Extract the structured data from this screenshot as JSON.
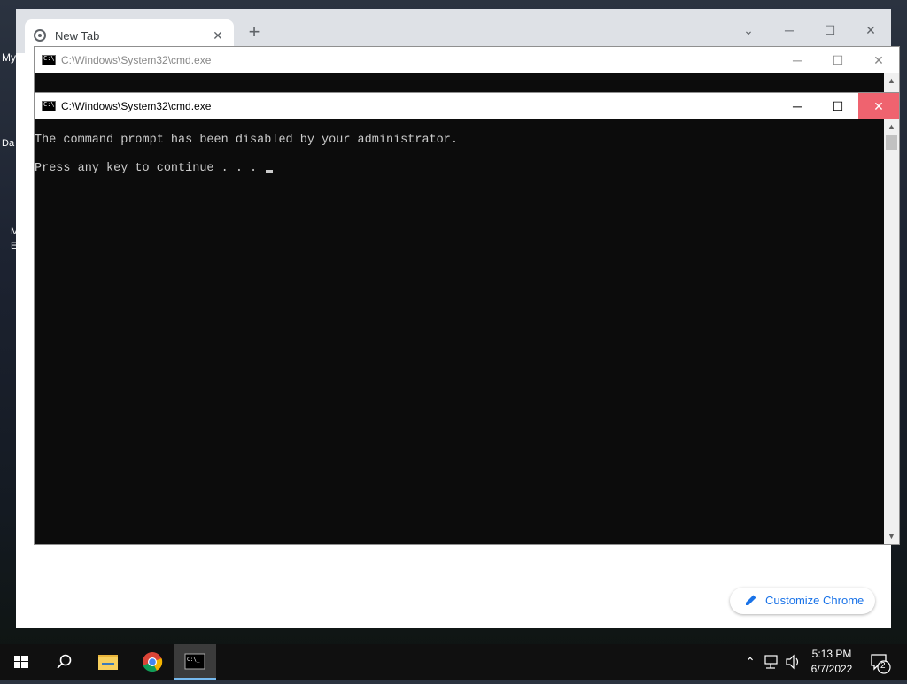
{
  "desktop": {
    "partial_labels": [
      "My",
      "Da",
      "M",
      "E"
    ]
  },
  "chrome": {
    "tab_title": "New Tab",
    "tab_close": "✕",
    "new_tab": "+",
    "tab_search": "⌄",
    "minimize": "─",
    "maximize": "☐",
    "close": "✕",
    "customize_label": "Customize Chrome"
  },
  "cmd_back": {
    "title": "C:\\Windows\\System32\\cmd.exe",
    "minimize": "─",
    "maximize": "☐",
    "close": "✕"
  },
  "cmd_front": {
    "title": "C:\\Windows\\System32\\cmd.exe",
    "minimize": "─",
    "maximize": "☐",
    "close": "✕",
    "line1": "The command prompt has been disabled by your administrator.",
    "line2": "Press any key to continue . . . ",
    "scroll_up": "▲",
    "scroll_down": "▼"
  },
  "taskbar": {
    "clock_time": "5:13 PM",
    "clock_date": "6/7/2022",
    "tray_chevron": "⌃",
    "notification_count": "2",
    "icons": [
      "start-icon",
      "search-icon",
      "file-explorer-icon",
      "chrome-icon",
      "cmd-icon"
    ]
  },
  "colors": {
    "close_hover": "#e81123",
    "console_bg": "#0c0c0c",
    "console_text": "#cccccc",
    "accent": "#1a73e8"
  }
}
